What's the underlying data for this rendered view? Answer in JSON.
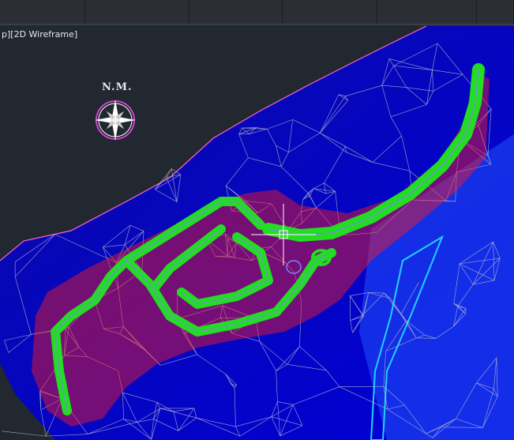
{
  "viewport": {
    "label": "p][2D Wireframe]"
  },
  "north_marker": {
    "label": "N.M."
  },
  "colors": {
    "background": "#212830",
    "terrain_fill": "#0000c8",
    "mesh_lines": "#c8c8d2",
    "road": "#22dd22",
    "fill_slope": "#ff1a1a",
    "boundary": "#ff66cc",
    "cyan_edge": "#22d0ff"
  },
  "icons": [
    "compass-rose-icon",
    "crosshair-cursor-icon"
  ]
}
